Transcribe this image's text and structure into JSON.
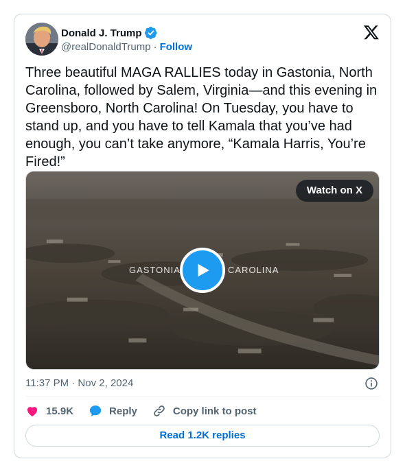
{
  "author": {
    "name": "Donald J. Trump",
    "handle": "@realDonaldTrump",
    "separator": "·",
    "follow_label": "Follow"
  },
  "tweet": {
    "text": "Three beautiful MAGA RALLIES today in Gastonia, North Carolina, followed by Salem, Virginia—and this evening in Greensboro, North Carolina! On Tuesday, you have to stand up, and you have to tell Kamala that you’ve had enough, you can’t take anymore, “Kamala Harris, You’re Fired!”",
    "timestamp": "11:37 PM · Nov 2, 2024"
  },
  "media": {
    "watch_label": "Watch on X",
    "overlay_left": "GASTONIA",
    "overlay_right": "CAROLINA"
  },
  "actions": {
    "like_count": "15.9K",
    "reply_label": "Reply",
    "copy_label": "Copy link to post"
  },
  "footer": {
    "read_replies_label": "Read 1.2K replies"
  },
  "colors": {
    "accent": "#1d9bf0",
    "link": "#006fd6",
    "like": "#f91880",
    "text": "#0f1419",
    "muted": "#536471"
  },
  "icons": [
    "x-logo-icon",
    "verified-badge-icon",
    "play-icon",
    "info-icon",
    "heart-icon",
    "reply-bubble-icon",
    "link-icon"
  ]
}
